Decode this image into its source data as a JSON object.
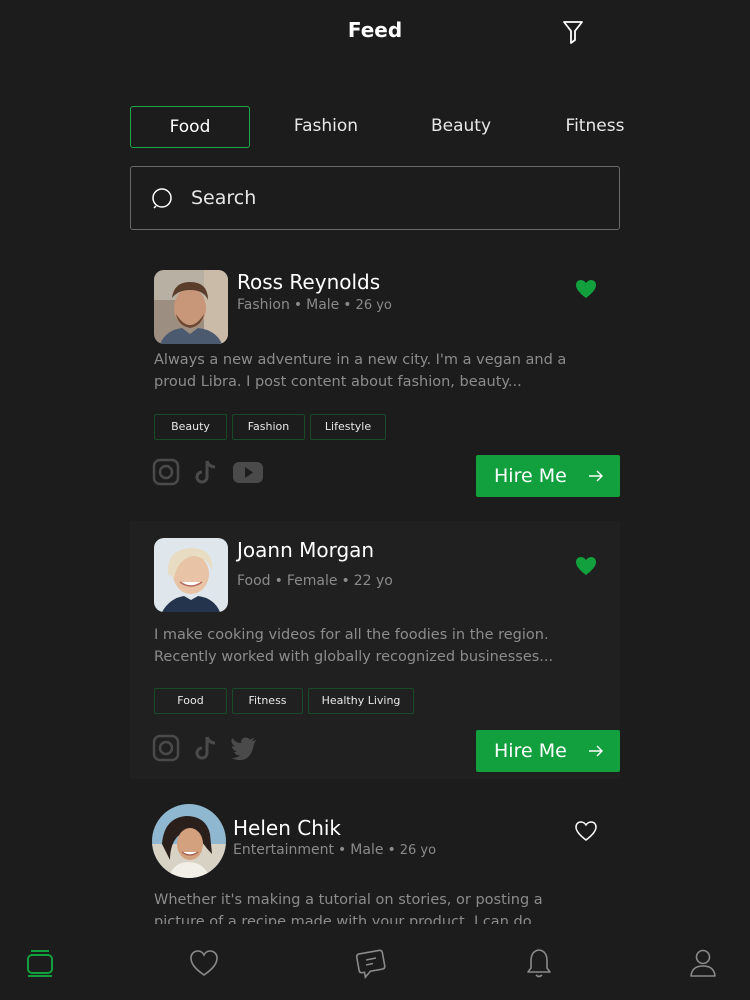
{
  "header": {
    "title": "Feed"
  },
  "tabs": [
    {
      "label": "Food",
      "active": true
    },
    {
      "label": "Fashion",
      "active": false
    },
    {
      "label": "Beauty",
      "active": false
    },
    {
      "label": "Fitness",
      "active": false
    }
  ],
  "search": {
    "placeholder": "Search",
    "value": ""
  },
  "creators": [
    {
      "name": "Ross Reynolds",
      "category": "Fashion",
      "gender": "Male",
      "age": "26 yo",
      "liked": true,
      "bio": "Always a new adventure in a new city. I'm a vegan and a proud Libra. I post content about fashion, beauty...",
      "tags": [
        "Beauty",
        "Fashion",
        "Lifestyle"
      ],
      "socials": [
        "instagram-icon",
        "tiktok-icon",
        "youtube-icon"
      ],
      "cta": "Hire Me"
    },
    {
      "name": "Joann Morgan",
      "category": "Food",
      "gender": "Female",
      "age": "22 yo",
      "liked": true,
      "bio": "I make cooking videos for all the foodies in the region. Recently worked with globally recognized businesses...",
      "tags": [
        "Food",
        "Fitness",
        "Healthy Living"
      ],
      "socials": [
        "instagram-icon",
        "tiktok-icon",
        "twitter-icon"
      ],
      "cta": "Hire Me"
    },
    {
      "name": "Helen Chik",
      "category": "Entertainment",
      "gender": "Male",
      "age": "26 yo",
      "liked": false,
      "bio": "Whether it's making a tutorial on stories, or posting a picture of a recipe made with your product, I can do..."
    }
  ],
  "bottom_nav": [
    "feed-icon",
    "heart-icon",
    "chat-icon",
    "bell-icon",
    "profile-icon"
  ],
  "colors": {
    "accent": "#12a03e",
    "background": "#1c1c1c",
    "muted_text": "#8c8c8c"
  }
}
